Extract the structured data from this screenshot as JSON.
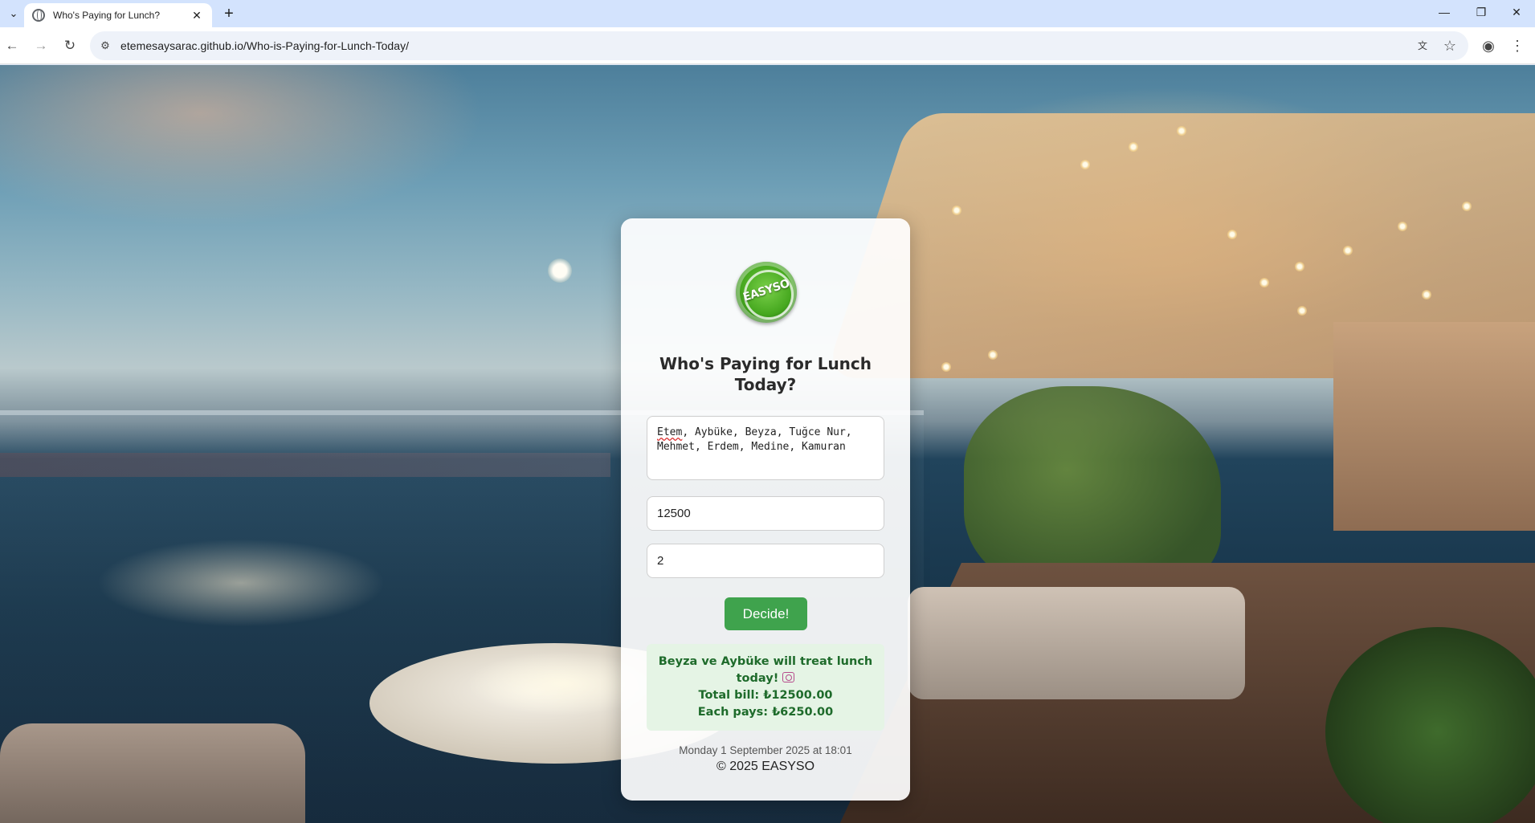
{
  "browser": {
    "tab_title": "Who's Paying for Lunch?",
    "tab_close": "✕",
    "new_tab": "+",
    "url": "etemesaysarac.github.io/Who-is-Paying-for-Lunch-Today/",
    "icons": [
      "tab-search-icon",
      "favicon-globe-icon",
      "close-icon",
      "new-tab-icon",
      "minimize-icon",
      "restore-icon",
      "window-close-icon",
      "back-icon",
      "forward-icon",
      "reload-icon",
      "site-info-icon",
      "translate-icon",
      "bookmark-star-icon",
      "profile-icon",
      "menu-icon"
    ]
  },
  "app": {
    "logo_text": "EASYSO",
    "title": "Who's Paying for Lunch Today?",
    "names_value": "Etem, Aybüke, Beyza, Tuğce Nur, Mehmet, Erdem, Medine, Kamuran",
    "names_first_word": "Etem",
    "names_rest": ", Aybüke, Beyza, Tuğce Nur, Mehmet, Erdem, Medine, Kamuran",
    "bill_value": "12500",
    "people_value": "2",
    "decide_label": "Decide!",
    "result_line1": "Beyza ve Aybüke will treat lunch today!",
    "result_total": "Total bill: ₺12500.00",
    "result_each": "Each pays: ₺6250.00",
    "datetime": "Monday 1 September 2025 at 18:01",
    "copyright": "© 2025 EASYSO"
  },
  "colors": {
    "accent_button": "#3fa34d",
    "result_background": "#e5f4e5",
    "result_text": "#1e6b2b",
    "tabbar": "#d3e3fd"
  }
}
